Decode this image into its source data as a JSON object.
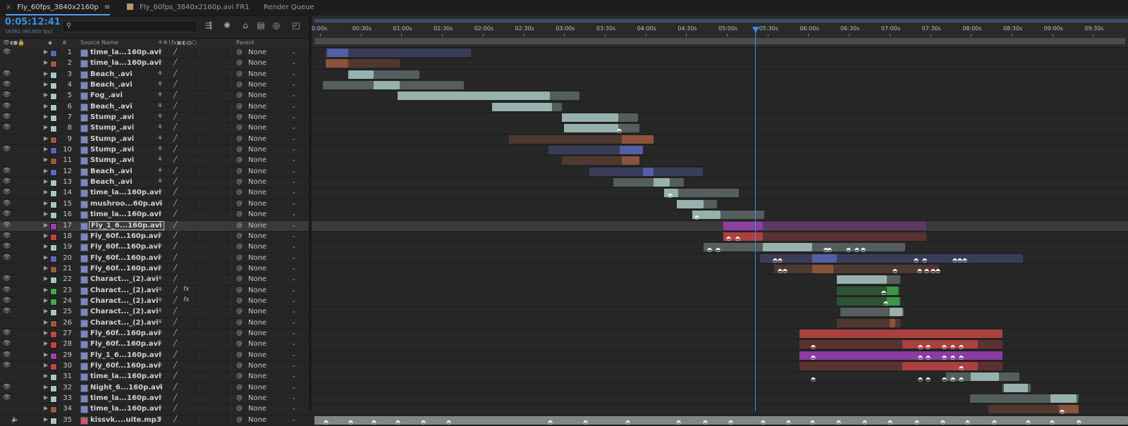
{
  "tabs": [
    {
      "label": "Fly_60fps_3840x2160p",
      "active": true,
      "close": "×",
      "menu": "≡"
    },
    {
      "label": "Fly_60fps_3840x2160p.avi FR1",
      "active": false
    },
    {
      "label": "Render Queue",
      "active": false
    }
  ],
  "timecode": "0:05:12:41",
  "frame_readout": "18761 (60.000 fps)",
  "search": {
    "placeholder": ""
  },
  "columns": {
    "hash": "#",
    "source_name": "Source Name",
    "parent": "Parent"
  },
  "ruler_ticks": [
    "0:00s",
    "00:30s",
    "01:00s",
    "01:30s",
    "02:00s",
    "02:30s",
    "03:00s",
    "03:30s",
    "04:00s",
    "04:30s",
    "05:00s",
    "05:30s",
    "06:00s",
    "06:30s",
    "07:00s",
    "07:30s",
    "08:00s",
    "08:30s",
    "09:00s",
    "09:30s"
  ],
  "layers": [
    {
      "n": "1",
      "name": "time_la...160p.avi",
      "color": "#5b66b8",
      "eye": true
    },
    {
      "n": "2",
      "name": "time_la...160p.avi",
      "color": "#9a5a3f",
      "eye": false
    },
    {
      "n": "3",
      "name": "Beach_.avi",
      "color": "#a8c7c2",
      "eye": true
    },
    {
      "n": "4",
      "name": "Beach_.avi",
      "color": "#a8c7c2",
      "eye": true
    },
    {
      "n": "5",
      "name": "Fog_.avi",
      "color": "#a8c7c2",
      "eye": true
    },
    {
      "n": "6",
      "name": "Beach_.avi",
      "color": "#a8c7c2",
      "eye": true
    },
    {
      "n": "7",
      "name": "Stump_.avi",
      "color": "#a8c7c2",
      "eye": true
    },
    {
      "n": "8",
      "name": "Stump_.avi",
      "color": "#a8c7c2",
      "eye": true
    },
    {
      "n": "9",
      "name": "Stump_.avi",
      "color": "#9a5a3f",
      "eye": false
    },
    {
      "n": "10",
      "name": "Stump_.avi",
      "color": "#5b66b8",
      "eye": true
    },
    {
      "n": "11",
      "name": "Stump_.avi",
      "color": "#9a5a3f",
      "eye": false
    },
    {
      "n": "12",
      "name": "Beach_.avi",
      "color": "#5b66b8",
      "eye": true
    },
    {
      "n": "13",
      "name": "Beach_.avi",
      "color": "#a8c7c2",
      "eye": true
    },
    {
      "n": "14",
      "name": "time_la...160p.avi",
      "color": "#a8c7c2",
      "eye": true
    },
    {
      "n": "15",
      "name": "mushroo...60p.avi",
      "color": "#a8c7c2",
      "eye": true
    },
    {
      "n": "16",
      "name": "time_la...160p.avi",
      "color": "#a8c7c2",
      "eye": true
    },
    {
      "n": "17",
      "name": "Fly_1_6...160p.avi",
      "color": "#9b3fb3",
      "eye": true
    },
    {
      "n": "18",
      "name": "Fly_60f...160p.avi",
      "color": "#c04545",
      "eye": true
    },
    {
      "n": "19",
      "name": "Fly_60f...160p.avi",
      "color": "#a8c7c2",
      "eye": true
    },
    {
      "n": "20",
      "name": "Fly_60f...160p.avi",
      "color": "#5b66b8",
      "eye": true
    },
    {
      "n": "21",
      "name": "Fly_60f...160p.avi",
      "color": "#9a5a3f",
      "eye": false
    },
    {
      "n": "22",
      "name": "Charact..._(2).avi",
      "color": "#a8c7c2",
      "eye": true
    },
    {
      "n": "23",
      "name": "Charact..._(2).avi",
      "color": "#3fa84a",
      "eye": true,
      "fx": true
    },
    {
      "n": "24",
      "name": "Charact..._(2).avi",
      "color": "#3fa84a",
      "eye": true,
      "fx": true
    },
    {
      "n": "25",
      "name": "Charact..._(2).avi",
      "color": "#a8c7c2",
      "eye": true
    },
    {
      "n": "26",
      "name": "Charact..._(2).avi",
      "color": "#9a5a3f",
      "eye": false
    },
    {
      "n": "27",
      "name": "Fly_60f...160p.avi",
      "color": "#c04545",
      "eye": true
    },
    {
      "n": "28",
      "name": "Fly_60f...160p.avi",
      "color": "#c04545",
      "eye": true
    },
    {
      "n": "29",
      "name": "Fly_1_6...160p.avi",
      "color": "#9b3fb3",
      "eye": true
    },
    {
      "n": "30",
      "name": "Fly_60f...160p.avi",
      "color": "#c04545",
      "eye": true
    },
    {
      "n": "31",
      "name": "time_la...160p.avi",
      "color": "#a8c7c2",
      "eye": false
    },
    {
      "n": "32",
      "name": "Night_6...160p.avi",
      "color": "#a8c7c2",
      "eye": true
    },
    {
      "n": "33",
      "name": "time_la...160p.avi",
      "color": "#a8c7c2",
      "eye": true
    },
    {
      "n": "34",
      "name": "time_la...160p.avi",
      "color": "#9a5a3f",
      "eye": false
    },
    {
      "n": "35",
      "name": "kissvk....uite.mp3",
      "color": "#a8c7c2",
      "eye": false,
      "audio": true
    }
  ],
  "parent_value": "None"
}
